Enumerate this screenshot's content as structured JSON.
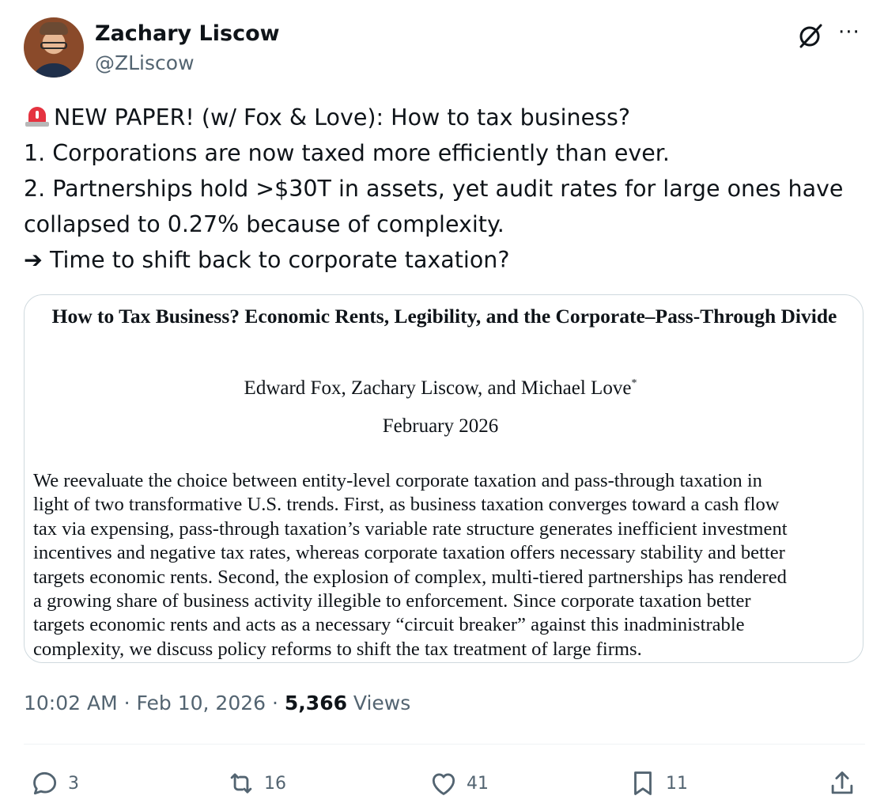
{
  "author": {
    "name": "Zachary Liscow",
    "handle": "@ZLiscow"
  },
  "header_icons": [
    "grok-icon",
    "more-icon"
  ],
  "more_label": "···",
  "tweet": {
    "lines": [
      "NEW PAPER! (w/ Fox & Love): How to tax business?",
      "1. Corporations are now taxed more efficiently than ever.",
      "2. Partnerships hold >$30T in assets, yet audit rates for large ones have",
      "collapsed to 0.27% because of complexity.",
      "➔ Time to shift back to corporate taxation?"
    ],
    "leading_emoji": "siren-icon"
  },
  "paper": {
    "title": "How to Tax Business? Economic Rents, Legibility, and the Corporate–Pass-Through Divide",
    "authors": "Edward Fox, Zachary Liscow, and Michael Love",
    "author_mark": "*",
    "date": "February 2026",
    "abstract_lines": [
      "We reevaluate the choice between entity-level corporate taxation and pass-through taxation in",
      "light of two transformative U.S. trends. First, as business taxation converges toward a cash flow",
      "tax via expensing, pass-through taxation’s variable rate structure generates inefficient investment",
      "incentives and negative tax rates, whereas corporate taxation offers necessary stability and better",
      "targets economic rents. Second, the explosion of complex, multi-tiered partnerships has rendered",
      "a growing share of business activity illegible to enforcement. Since corporate taxation better",
      "targets economic rents and acts as a necessary “circuit breaker” against this inadministrable",
      "complexity, we discuss policy reforms to shift the tax treatment of large firms."
    ]
  },
  "meta": {
    "time": "10:02 AM",
    "sep1": " · ",
    "date": "Feb 10, 2026",
    "sep2": " · ",
    "views_count": "5,366",
    "views_label": " Views"
  },
  "actions": {
    "replies": "3",
    "reposts": "16",
    "likes": "41",
    "bookmarks": "11"
  },
  "colors": {
    "text": "#0f1419",
    "secondary": "#536471",
    "border": "#cfd9de",
    "siren": "#e53340"
  }
}
